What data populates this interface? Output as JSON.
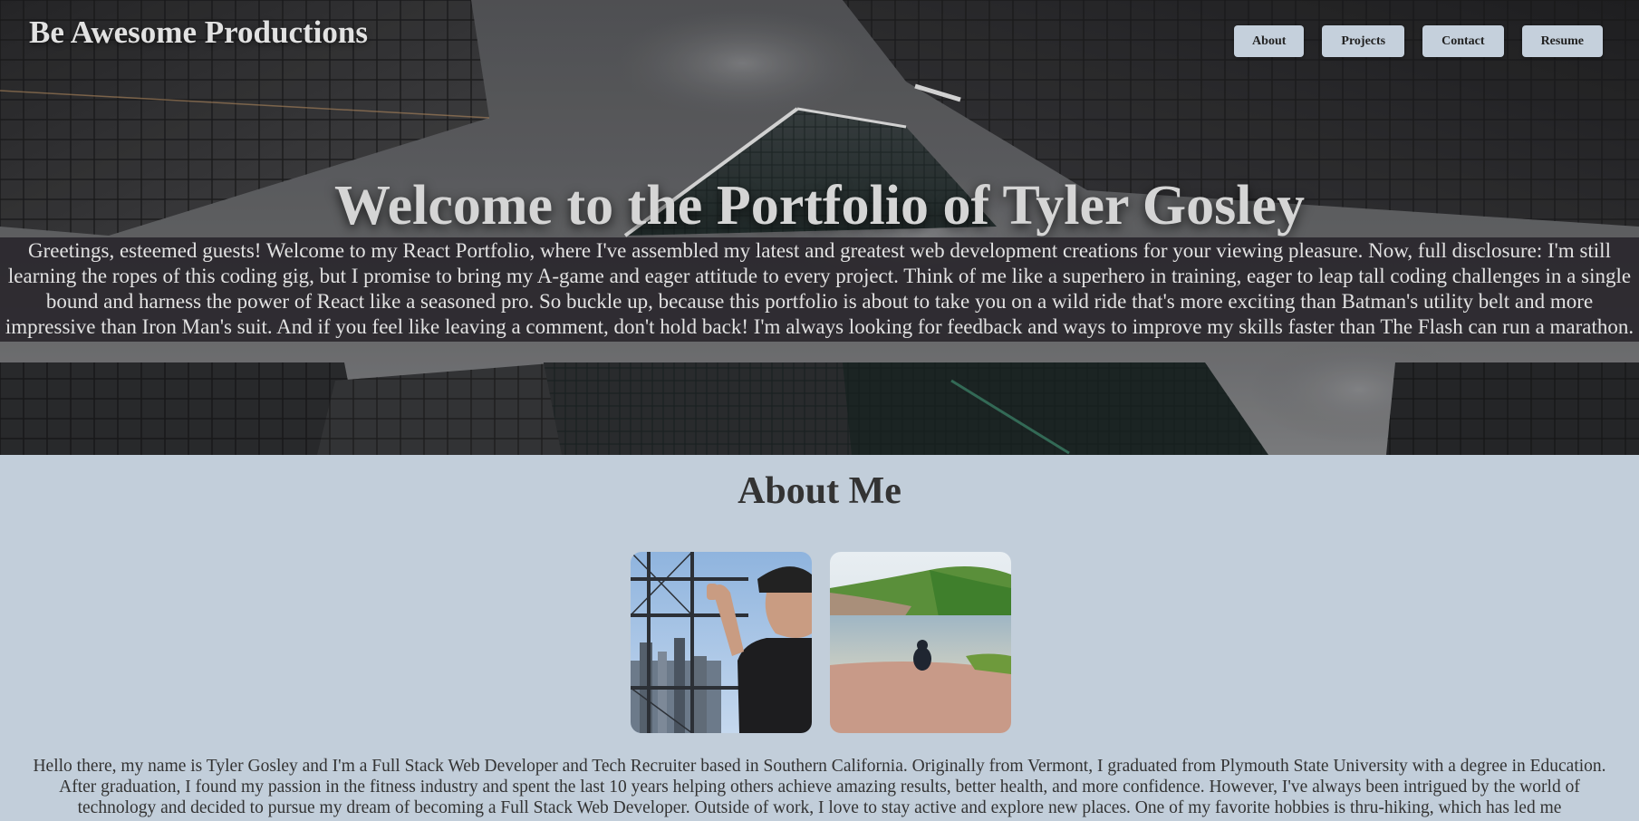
{
  "header": {
    "brand": "Be Awesome Productions",
    "nav": [
      {
        "label": "About"
      },
      {
        "label": "Projects"
      },
      {
        "label": "Contact"
      },
      {
        "label": "Resume"
      }
    ]
  },
  "hero": {
    "title": "Welcome to the Portfolio of Tyler Gosley",
    "intro": "Greetings, esteemed guests! Welcome to my React Portfolio, where I've assembled my latest and greatest web development creations for your viewing pleasure. Now, full disclosure: I'm still learning the ropes of this coding gig, but I promise to bring my A-game and eager attitude to every project. Think of me like a superhero in training, eager to leap tall coding challenges in a single bound and harness the power of React like a seasoned pro. So buckle up, because this portfolio is about to take you on a wild ride that's more exciting than Batman's utility belt and more impressive than Iron Man's suit. And if you feel like leaving a comment, don't hold back! I'm always looking for feedback and ways to improve my skills faster than The Flash can run a marathon."
  },
  "about": {
    "title": "About Me",
    "text": "Hello there, my name is Tyler Gosley and I'm a Full Stack Web Developer and Tech Recruiter based in Southern California. Originally from Vermont, I graduated from Plymouth State University with a degree in Education. After graduation, I found my passion in the fitness industry and spent the last 10 years helping others achieve amazing results, better health, and more confidence. However, I've always been intrigued by the world of technology and decided to pursue my dream of becoming a Full Stack Web Developer. Outside of work, I love to stay active and explore new places. One of my favorite hobbies is thru-hiking, which has led me"
  },
  "colors": {
    "page_bg": "#c2ceda",
    "nav_button_bg": "#c5d0dc",
    "intro_band_bg": "#28242a",
    "heading_text": "#333333",
    "hero_text": "#d5d5d5"
  }
}
